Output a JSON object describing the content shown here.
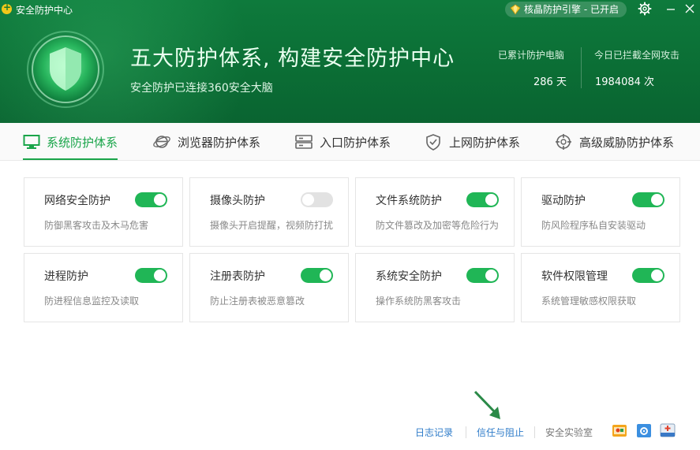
{
  "window": {
    "title": "安全防护中心",
    "engine_status": "核晶防护引擎 - 已开启"
  },
  "hero": {
    "headline": "五大防护体系, 构建安全防护中心",
    "subline": "安全防护已连接360安全大脑",
    "stats": [
      {
        "label": "已累计防护电脑",
        "value": "286 天"
      },
      {
        "label": "今日已拦截全网攻击",
        "value": "1984084 次"
      }
    ]
  },
  "tabs": [
    {
      "label": "系统防护体系",
      "icon": "monitor-icon",
      "active": true
    },
    {
      "label": "浏览器防护体系",
      "icon": "browser-e-icon",
      "active": false
    },
    {
      "label": "入口防护体系",
      "icon": "entrance-box-icon",
      "active": false
    },
    {
      "label": "上网防护体系",
      "icon": "shield-check-icon",
      "active": false
    },
    {
      "label": "高级威胁防护体系",
      "icon": "crosshair-icon",
      "active": false
    }
  ],
  "protections": [
    {
      "title": "网络安全防护",
      "desc": "防御黑客攻击及木马危害",
      "enabled": true
    },
    {
      "title": "摄像头防护",
      "desc": "摄像头开启提醒，视频防打扰",
      "enabled": false
    },
    {
      "title": "文件系统防护",
      "desc": "防文件篡改及加密等危险行为",
      "enabled": true
    },
    {
      "title": "驱动防护",
      "desc": "防风险程序私自安装驱动",
      "enabled": true
    },
    {
      "title": "进程防护",
      "desc": "防进程信息监控及读取",
      "enabled": true
    },
    {
      "title": "注册表防护",
      "desc": "防止注册表被恶意篡改",
      "enabled": true
    },
    {
      "title": "系统安全防护",
      "desc": "操作系统防黑客攻击",
      "enabled": true
    },
    {
      "title": "软件权限管理",
      "desc": "系统管理敏感权限获取",
      "enabled": true
    }
  ],
  "footer": {
    "log": "日志记录",
    "trust_block": "信任与阻止",
    "lab": "安全实验室",
    "icons": [
      "lab-app-icon",
      "settings-app-icon",
      "firstaid-app-icon"
    ]
  },
  "colors": {
    "brand_green": "#1aa54a",
    "header_green": "#0b6e35",
    "toggle_on": "#20b656",
    "toggle_off": "#e2e2e2",
    "link_blue": "#2f7cc9"
  }
}
